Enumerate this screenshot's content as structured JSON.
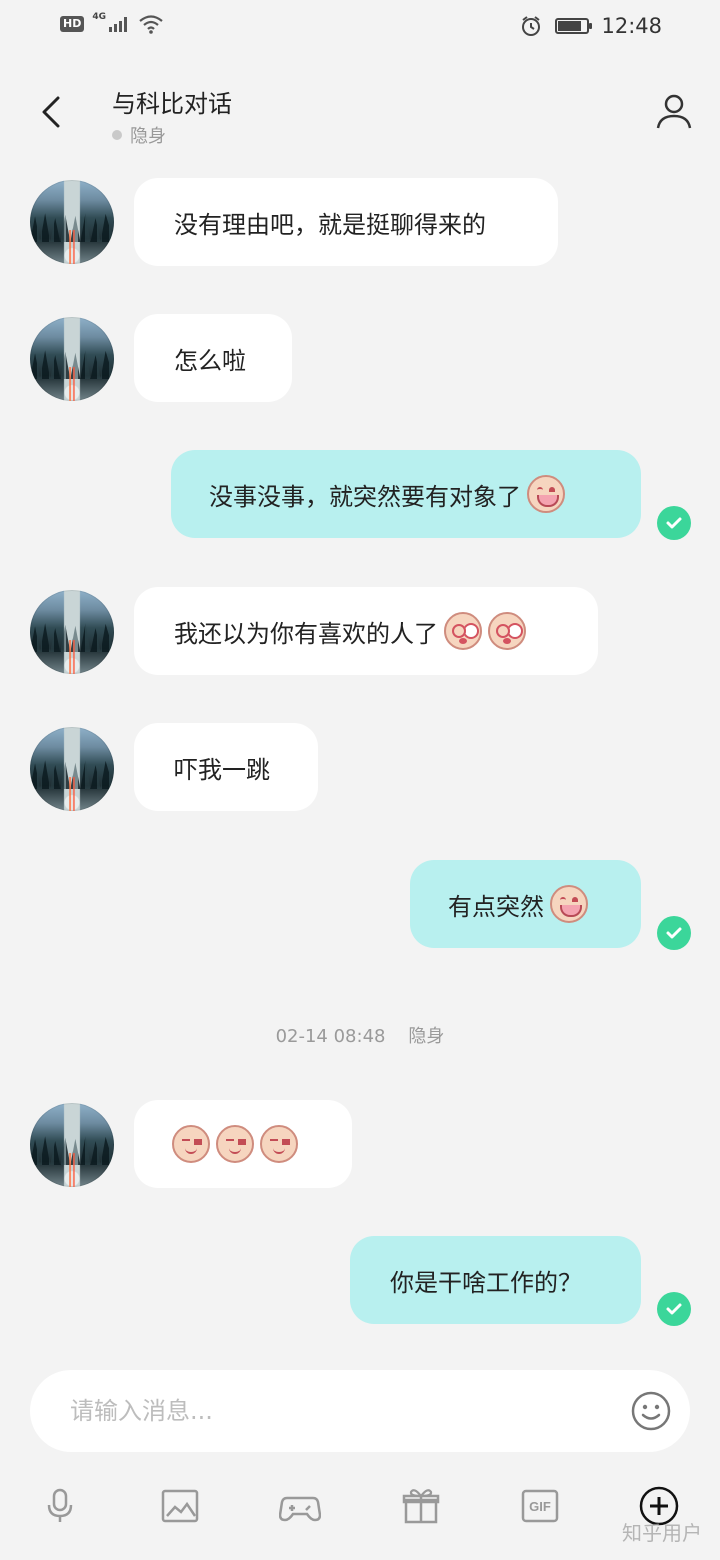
{
  "status_bar": {
    "hd": "HD",
    "network": "4G",
    "time": "12:48",
    "battery_level": 0.82,
    "icons": [
      "signal-icon",
      "wifi-icon",
      "alarm-icon",
      "battery-icon"
    ]
  },
  "header": {
    "title": "与科比对话",
    "presence": "隐身",
    "back_icon": "back-chevron-icon",
    "profile_icon": "profile-icon"
  },
  "messages": [
    {
      "direction": "in",
      "text": "没有理由吧，就是挺聊得来的",
      "emojis": []
    },
    {
      "direction": "in",
      "text": "怎么啦",
      "emojis": []
    },
    {
      "direction": "out",
      "text": "没事没事，就突然要有对象了",
      "emojis": [
        "laugh-cry-emoji"
      ],
      "status": "sent"
    },
    {
      "direction": "in",
      "text": "我还以为你有喜欢的人了",
      "emojis": [
        "shocked-emoji",
        "shocked-emoji"
      ]
    },
    {
      "direction": "in",
      "text": "吓我一跳",
      "emojis": []
    },
    {
      "direction": "out",
      "text": "有点突然",
      "emojis": [
        "laugh-cry-emoji"
      ],
      "status": "sent"
    },
    {
      "direction": "in",
      "text": "",
      "emojis": [
        "side-eye-emoji",
        "side-eye-emoji",
        "side-eye-emoji"
      ]
    },
    {
      "direction": "out",
      "text": "你是干啥工作的？",
      "emojis": [],
      "status": "sent"
    }
  ],
  "timestamp": {
    "text": "02-14 08:48",
    "status": "隐身"
  },
  "composer": {
    "placeholder": "请输入消息..."
  },
  "toolbar": {
    "items": [
      {
        "name": "microphone-icon"
      },
      {
        "name": "image-icon"
      },
      {
        "name": "game-controller-icon"
      },
      {
        "name": "gift-icon"
      },
      {
        "name": "gif-icon",
        "label": "GIF"
      },
      {
        "name": "add-icon"
      }
    ]
  },
  "watermark": "知乎用户",
  "colors": {
    "background": "#f3f3f3",
    "incoming_bubble": "#ffffff",
    "outgoing_bubble": "#b8f0ef",
    "read_check": "#3bd69a",
    "muted_text": "#9a9a9a"
  }
}
